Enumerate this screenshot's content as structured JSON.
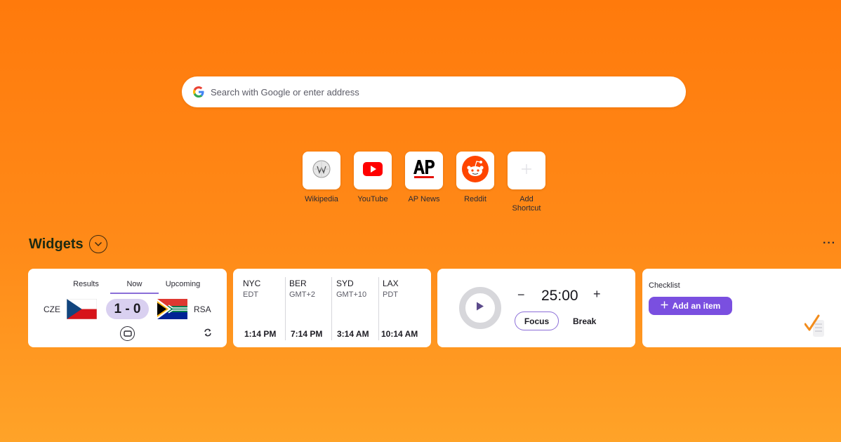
{
  "search": {
    "placeholder": "Search with Google or enter address",
    "icon": "google-g-icon"
  },
  "shortcuts": [
    {
      "label": "Wikipedia",
      "icon": "wikipedia-icon"
    },
    {
      "label": "YouTube",
      "icon": "youtube-icon"
    },
    {
      "label": "AP News",
      "icon": "ap-news-icon"
    },
    {
      "label": "Reddit",
      "icon": "reddit-icon"
    },
    {
      "label": "Add Shortcut",
      "icon": "plus-icon"
    }
  ],
  "widgets": {
    "title": "Widgets",
    "sports": {
      "tabs": [
        "Results",
        "Now",
        "Upcoming"
      ],
      "active_tab": "Now",
      "home": "CZE",
      "away": "RSA",
      "score": "1 - 0"
    },
    "clocks": [
      {
        "city": "NYC",
        "tz": "EDT",
        "time": "1:14 PM"
      },
      {
        "city": "BER",
        "tz": "GMT+2",
        "time": "7:14 PM"
      },
      {
        "city": "SYD",
        "tz": "GMT+10",
        "time": "3:14 AM"
      },
      {
        "city": "LAX",
        "tz": "PDT",
        "time": "10:14 AM"
      }
    ],
    "timer": {
      "value": "25:00",
      "minus": "−",
      "plus": "+",
      "focus_label": "Focus",
      "break_label": "Break"
    },
    "checklist": {
      "title": "Checklist",
      "add_label": "Add an item"
    }
  },
  "colors": {
    "accent": "#7a4fe0",
    "background": "#ff7a0c"
  }
}
